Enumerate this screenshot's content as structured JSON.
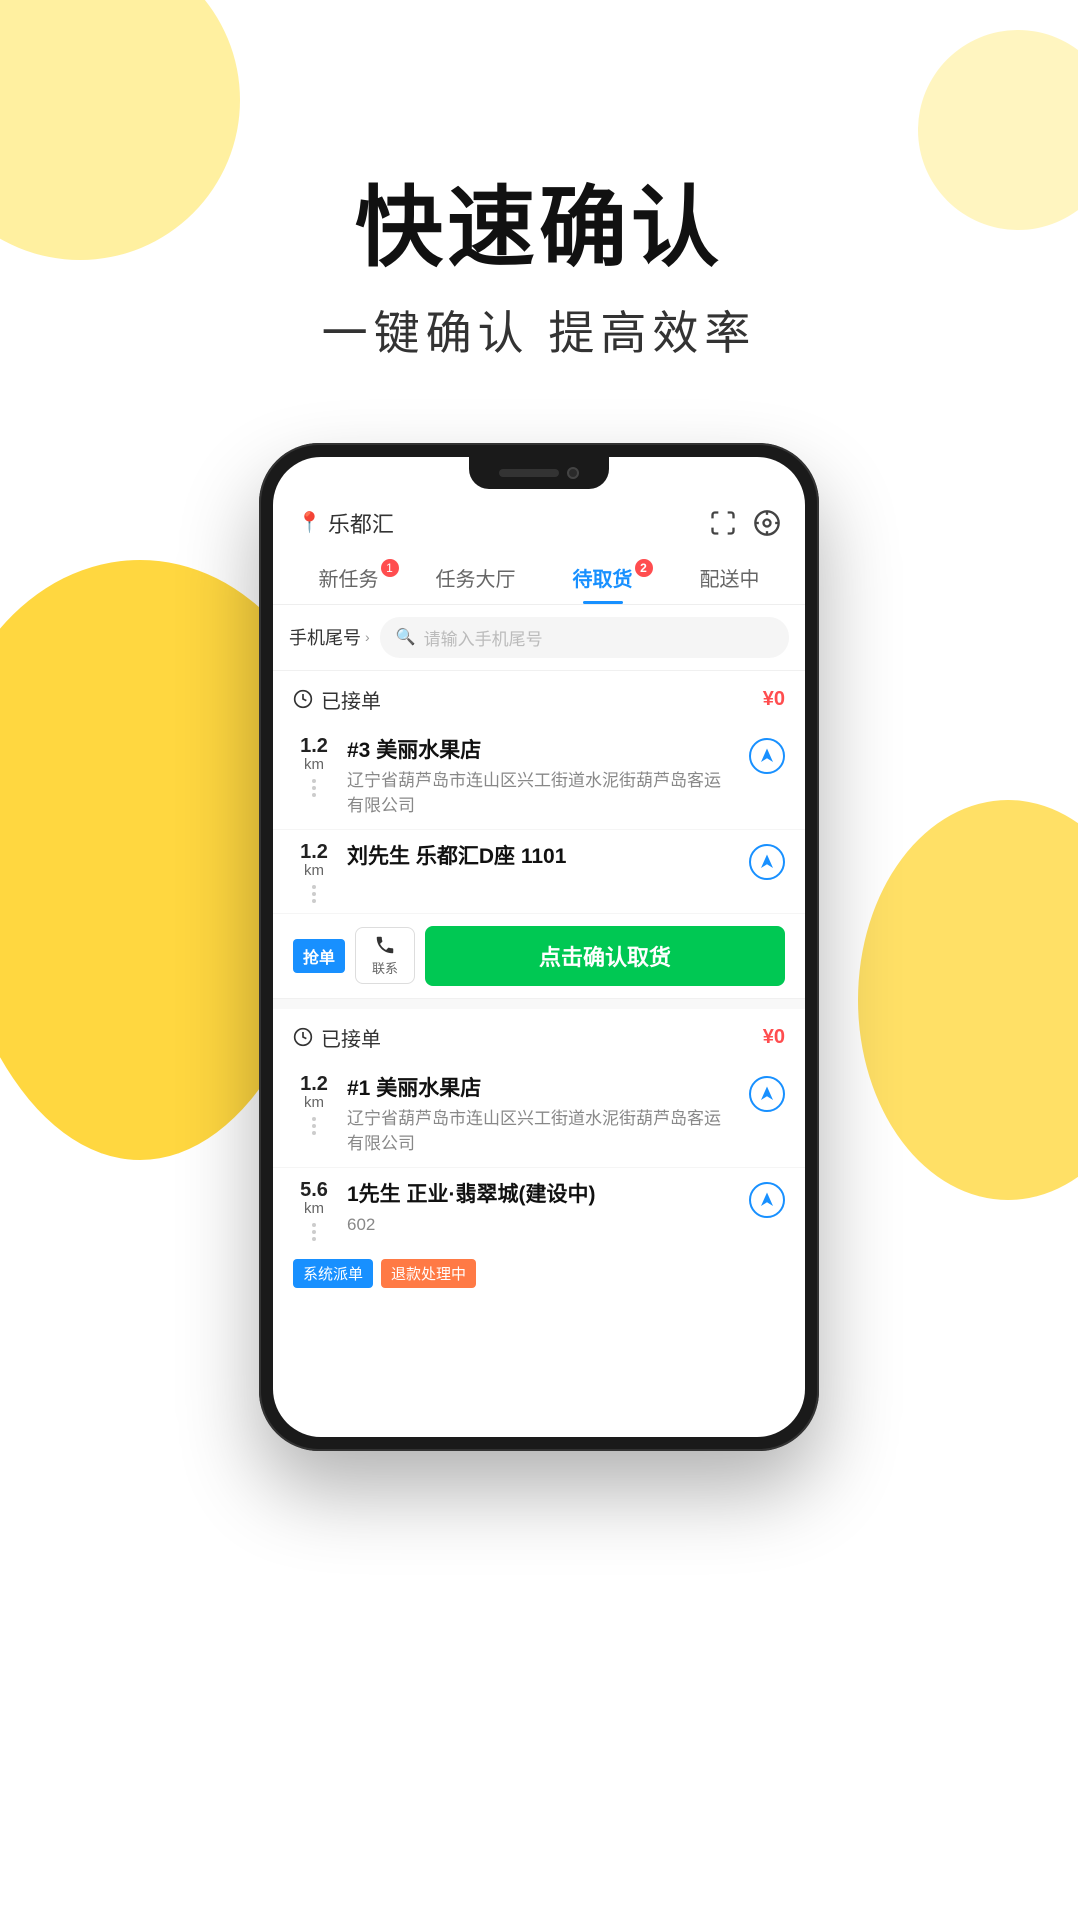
{
  "page": {
    "background": {
      "blob_colors": [
        "#FFF0A0",
        "#FFF5C0",
        "#FFD740",
        "#FFE066"
      ]
    },
    "hero": {
      "title": "快速确认",
      "subtitle": "一键确认 提高效率"
    },
    "phone": {
      "location": "乐都汇",
      "header_icons": [
        "expand-icon",
        "target-icon"
      ],
      "tabs": [
        {
          "label": "新任务",
          "badge": "1",
          "active": false
        },
        {
          "label": "任务大厅",
          "badge": null,
          "active": false
        },
        {
          "label": "待取货",
          "badge": "2",
          "active": true
        },
        {
          "label": "配送中",
          "badge": null,
          "active": false
        }
      ],
      "search": {
        "filter_label": "手机尾号",
        "placeholder": "请输入手机尾号"
      },
      "sections": [
        {
          "id": "section1",
          "title": "已接单",
          "price": "¥0",
          "orders": [
            {
              "id": "order1",
              "distance": "1.2",
              "unit": "km",
              "store_name": "#3 美丽水果店",
              "store_address": "辽宁省葫芦岛市连山区兴工街道水泥街葫芦岛客运有限公司",
              "show_nav": true
            },
            {
              "id": "order2",
              "distance": "1.2",
              "unit": "km",
              "store_name": "刘先生 乐都汇D座 1101",
              "store_address": "",
              "show_nav": true,
              "has_grab": true,
              "grab_label": "抢单"
            }
          ],
          "action": {
            "contact_label": "联系",
            "confirm_label": "点击确认取货"
          }
        },
        {
          "id": "section2",
          "title": "已接单",
          "price": "¥0",
          "orders": [
            {
              "id": "order3",
              "distance": "1.2",
              "unit": "km",
              "store_name": "#1 美丽水果店",
              "store_address": "辽宁省葫芦岛市连山区兴工街道水泥街葫芦岛客运有限公司",
              "show_nav": true
            },
            {
              "id": "order4",
              "distance": "5.6",
              "unit": "km",
              "store_name": "1先生 正业·翡翠城(建设中)",
              "store_address": "602",
              "show_nav": true
            }
          ],
          "badges": [
            "系统派单",
            "退款处理中"
          ]
        }
      ]
    }
  }
}
